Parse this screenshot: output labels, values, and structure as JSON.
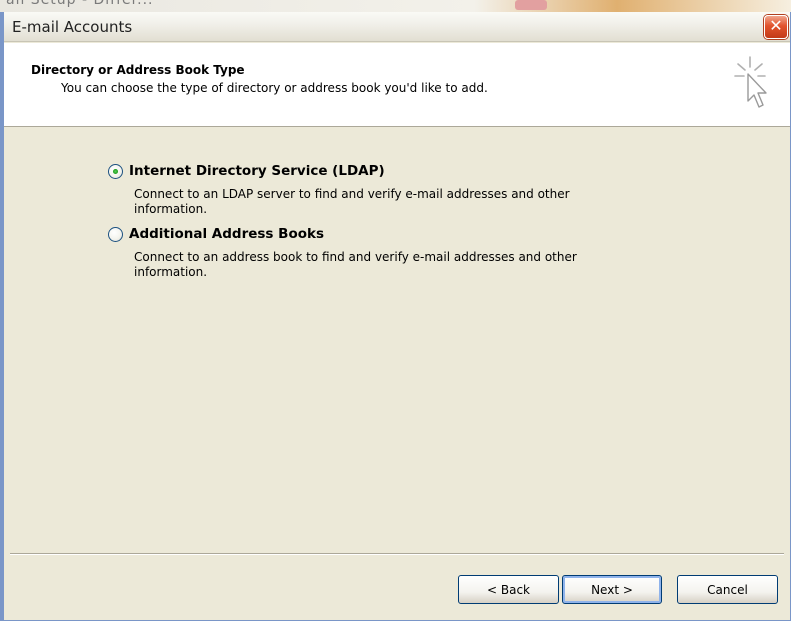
{
  "background_app": {
    "partial_text": "ail Setup - Differ..."
  },
  "dialog": {
    "title": "E-mail Accounts",
    "close_glyph": "✕"
  },
  "header": {
    "title": "Directory or Address Book Type",
    "subtitle": "You can choose the type of directory or address book you'd like to add.",
    "icon": "wizard-cursor-icon"
  },
  "options": [
    {
      "label": "Internet Directory Service (LDAP)",
      "description": "Connect to an LDAP server to find and verify e-mail addresses and other information.",
      "selected": true
    },
    {
      "label": "Additional Address Books",
      "description": "Connect to an address book to find and verify e-mail addresses and other information.",
      "selected": false
    }
  ],
  "buttons": {
    "back": "< Back",
    "next": "Next >",
    "cancel": "Cancel"
  },
  "colors": {
    "dialog_bg": "#ece9d8",
    "header_bg": "#ffffff",
    "close_red": "#e2532d",
    "radio_green": "#21a121",
    "button_border": "#003c74"
  }
}
